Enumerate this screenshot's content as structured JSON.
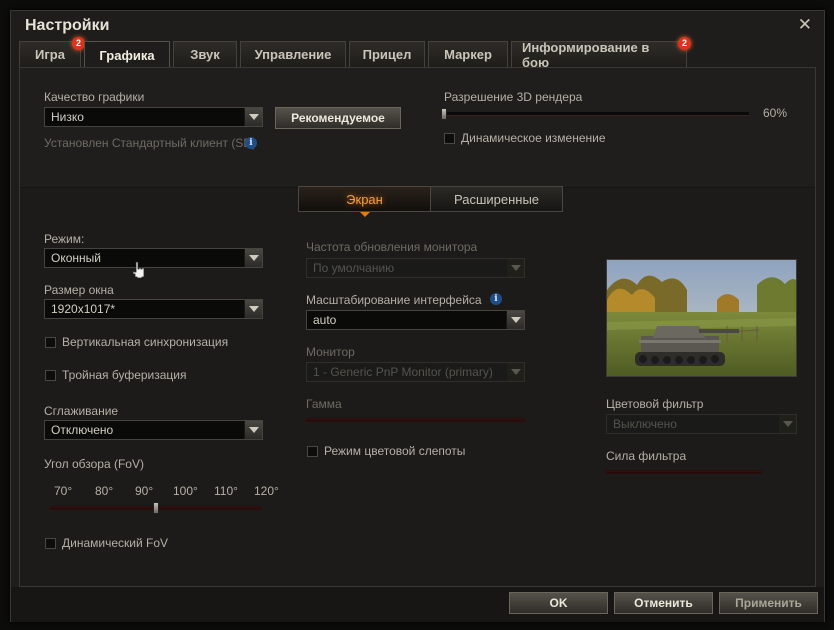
{
  "window": {
    "title": "Настройки"
  },
  "tabs": [
    {
      "label": "Игра",
      "badge": "2"
    },
    {
      "label": "Графика",
      "badge": ""
    },
    {
      "label": "Звук",
      "badge": ""
    },
    {
      "label": "Управление",
      "badge": ""
    },
    {
      "label": "Прицел",
      "badge": ""
    },
    {
      "label": "Маркер",
      "badge": ""
    },
    {
      "label": "Информирование в бою",
      "badge": "2"
    }
  ],
  "quality": {
    "label": "Качество графики",
    "value": "Низко",
    "recommended_button": "Рекомендуемое",
    "client_note": "Установлен Стандартный клиент (SD)"
  },
  "render": {
    "label": "Разрешение 3D рендера",
    "value_text": "60%",
    "value": 0.6,
    "dynamic_label": "Динамическое изменение"
  },
  "subtabs": {
    "screen": "Экран",
    "advanced": "Расширенные"
  },
  "left": {
    "mode_label": "Режим:",
    "mode_value": "Оконный",
    "window_size_label": "Размер окна",
    "window_size_value": "1920x1017*",
    "vsync_label": "Вертикальная синхронизация",
    "triple_label": "Тройная буферизация",
    "aa_label": "Сглаживание",
    "aa_value": "Отключено",
    "fov_label": "Угол обзора (FoV)",
    "fov_ticks": [
      "70°",
      "80°",
      "90°",
      "100°",
      "110°",
      "120°"
    ],
    "fov_value": 95,
    "fov_range": [
      70,
      120
    ],
    "dynamic_fov_label": "Динамический FoV"
  },
  "middle": {
    "refresh_label": "Частота обновления монитора",
    "refresh_value": "По умолчанию",
    "scale_label": "Масштабирование интерфейса",
    "scale_value": "auto",
    "monitor_label": "Монитор",
    "monitor_value": "1 - Generic PnP Monitor (primary)",
    "gamma_label": "Гамма",
    "colorblind_label": "Режим цветовой слепоты"
  },
  "right": {
    "color_filter_label": "Цветовой фильтр",
    "color_filter_value": "Выключено",
    "filter_strength_label": "Сила фильтра"
  },
  "footer": {
    "ok": "OK",
    "cancel": "Отменить",
    "apply": "Применить"
  },
  "info_icon_glyph": "i",
  "close_glyph": "✕"
}
